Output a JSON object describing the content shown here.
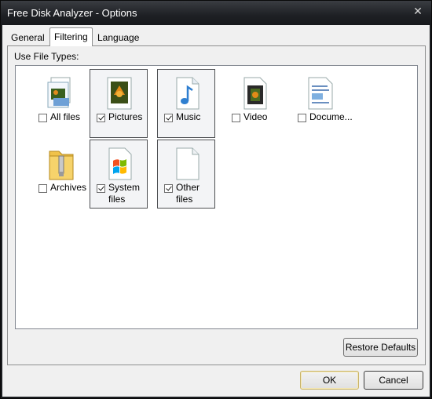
{
  "window": {
    "title": "Free Disk Analyzer - Options",
    "close_symbol": "✕"
  },
  "tabs": [
    {
      "label": "General",
      "active": false
    },
    {
      "label": "Filtering",
      "active": true
    },
    {
      "label": "Language",
      "active": false
    }
  ],
  "filtering": {
    "group_label": "Use File Types:",
    "items": [
      {
        "label": "All files",
        "checked": false,
        "icon": "all-files-icon"
      },
      {
        "label": "Pictures",
        "checked": true,
        "icon": "pictures-icon"
      },
      {
        "label": "Music",
        "checked": true,
        "icon": "music-icon"
      },
      {
        "label": "Video",
        "checked": false,
        "icon": "video-icon"
      },
      {
        "label": "Docume...",
        "checked": false,
        "icon": "documents-icon"
      },
      {
        "label": "Archives",
        "checked": false,
        "icon": "archives-icon"
      },
      {
        "label": "System files",
        "checked": true,
        "icon": "system-files-icon"
      },
      {
        "label": "Other files",
        "checked": true,
        "icon": "other-files-icon"
      }
    ],
    "restore_defaults": "Restore Defaults"
  },
  "buttons": {
    "ok": "OK",
    "cancel": "Cancel"
  },
  "colors": {
    "titlebar": "#1e2024",
    "selection_border": "#4d4f52",
    "default_button_border": "#c8b46a"
  }
}
